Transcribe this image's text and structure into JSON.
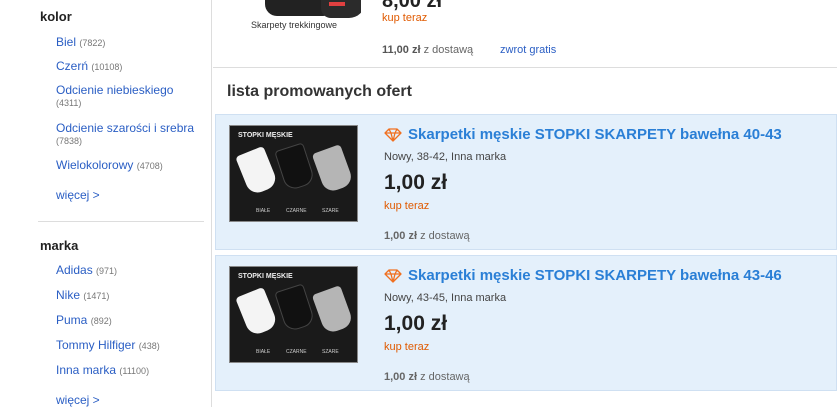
{
  "sidebar": {
    "color": {
      "title": "kolor",
      "items": [
        {
          "label": "Biel",
          "count": "(7822)"
        },
        {
          "label": "Czerń",
          "count": "(10108)"
        },
        {
          "label": "Odcienie niebieskiego",
          "count": "(4311)"
        },
        {
          "label": "Odcienie szarości i srebra",
          "count": "(7838)"
        },
        {
          "label": "Wielokolorowy",
          "count": "(4708)"
        }
      ],
      "more": "więcej >"
    },
    "brand": {
      "title": "marka",
      "items": [
        {
          "label": "Adidas",
          "count": "(971)"
        },
        {
          "label": "Nike",
          "count": "(1471)"
        },
        {
          "label": "Puma",
          "count": "(892)"
        },
        {
          "label": "Tommy Hilfiger",
          "count": "(438)"
        },
        {
          "label": "Inna marka",
          "count": "(11100)"
        }
      ],
      "more": "więcej >"
    }
  },
  "top_listing": {
    "image_label": "Skarpety trekkingowe",
    "price": "8,00 zł",
    "buy_now": "kup teraz",
    "delivery_price": "11,00 zł",
    "delivery_suffix": "z dostawą",
    "free_return": "zwrot gratis"
  },
  "promoted": {
    "heading": "lista promowanych ofert",
    "offers": [
      {
        "title": "Skarpetki męskie STOPKI SKARPETY bawełna 40-43",
        "subtitle": "Nowy, 38-42, Inna marka",
        "price": "1,00 zł",
        "buy_now": "kup teraz",
        "delivery_price": "1,00 zł",
        "delivery_suffix": "z dostawą",
        "image_header": "STOPKI MĘSKIE",
        "image_labels": [
          "BIAŁE",
          "CZARNE",
          "SZARE"
        ]
      },
      {
        "title": "Skarpetki męskie STOPKI SKARPETY bawełna 43-46",
        "subtitle": "Nowy, 43-45, Inna marka",
        "price": "1,00 zł",
        "buy_now": "kup teraz",
        "delivery_price": "1,00 zł",
        "delivery_suffix": "z dostawą",
        "image_header": "STOPKI MĘSKIE",
        "image_labels": [
          "BIAŁE",
          "CZARNE",
          "SZARE"
        ]
      }
    ]
  },
  "colors": {
    "link": "#2a5ec4",
    "title_link": "#2a7fd6",
    "buy_now": "#e05a00",
    "promo_bg": "#e4f0fb",
    "diamond": "#f07020"
  }
}
